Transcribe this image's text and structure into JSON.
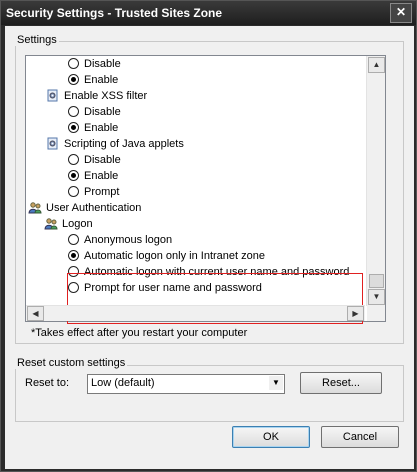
{
  "window": {
    "title": "Security Settings - Trusted Sites Zone",
    "close_glyph": "✕"
  },
  "settings": {
    "group_label": "Settings",
    "items": [
      {
        "kind": "radio",
        "label": "Disable",
        "checked": false
      },
      {
        "kind": "radio",
        "label": "Enable",
        "checked": true
      },
      {
        "kind": "category",
        "label": "Enable XSS filter",
        "icon": "settings-category-icon"
      },
      {
        "kind": "radio",
        "label": "Disable",
        "checked": false
      },
      {
        "kind": "radio",
        "label": "Enable",
        "checked": true
      },
      {
        "kind": "category",
        "label": "Scripting of Java applets",
        "icon": "settings-category-icon"
      },
      {
        "kind": "radio",
        "label": "Disable",
        "checked": false
      },
      {
        "kind": "radio",
        "label": "Enable",
        "checked": true
      },
      {
        "kind": "radio",
        "label": "Prompt",
        "checked": false
      },
      {
        "kind": "category",
        "label": "User Authentication",
        "icon": "users-icon"
      },
      {
        "kind": "category",
        "label": "Logon",
        "icon": "users-icon"
      },
      {
        "kind": "radio",
        "label": "Anonymous logon",
        "checked": false
      },
      {
        "kind": "radio",
        "label": "Automatic logon only in Intranet zone",
        "checked": true
      },
      {
        "kind": "radio",
        "label": "Automatic logon with current user name and password",
        "checked": false
      },
      {
        "kind": "radio",
        "label": "Prompt for user name and password",
        "checked": false
      }
    ],
    "note": "*Takes effect after you restart your computer"
  },
  "reset": {
    "group_label": "Reset custom settings",
    "label": "Reset to:",
    "selected": "Low (default)",
    "button": "Reset..."
  },
  "footer": {
    "ok": "OK",
    "cancel": "Cancel"
  },
  "colors": {
    "highlight_border": "#e02020",
    "titlebar": "#1e1e1e"
  }
}
